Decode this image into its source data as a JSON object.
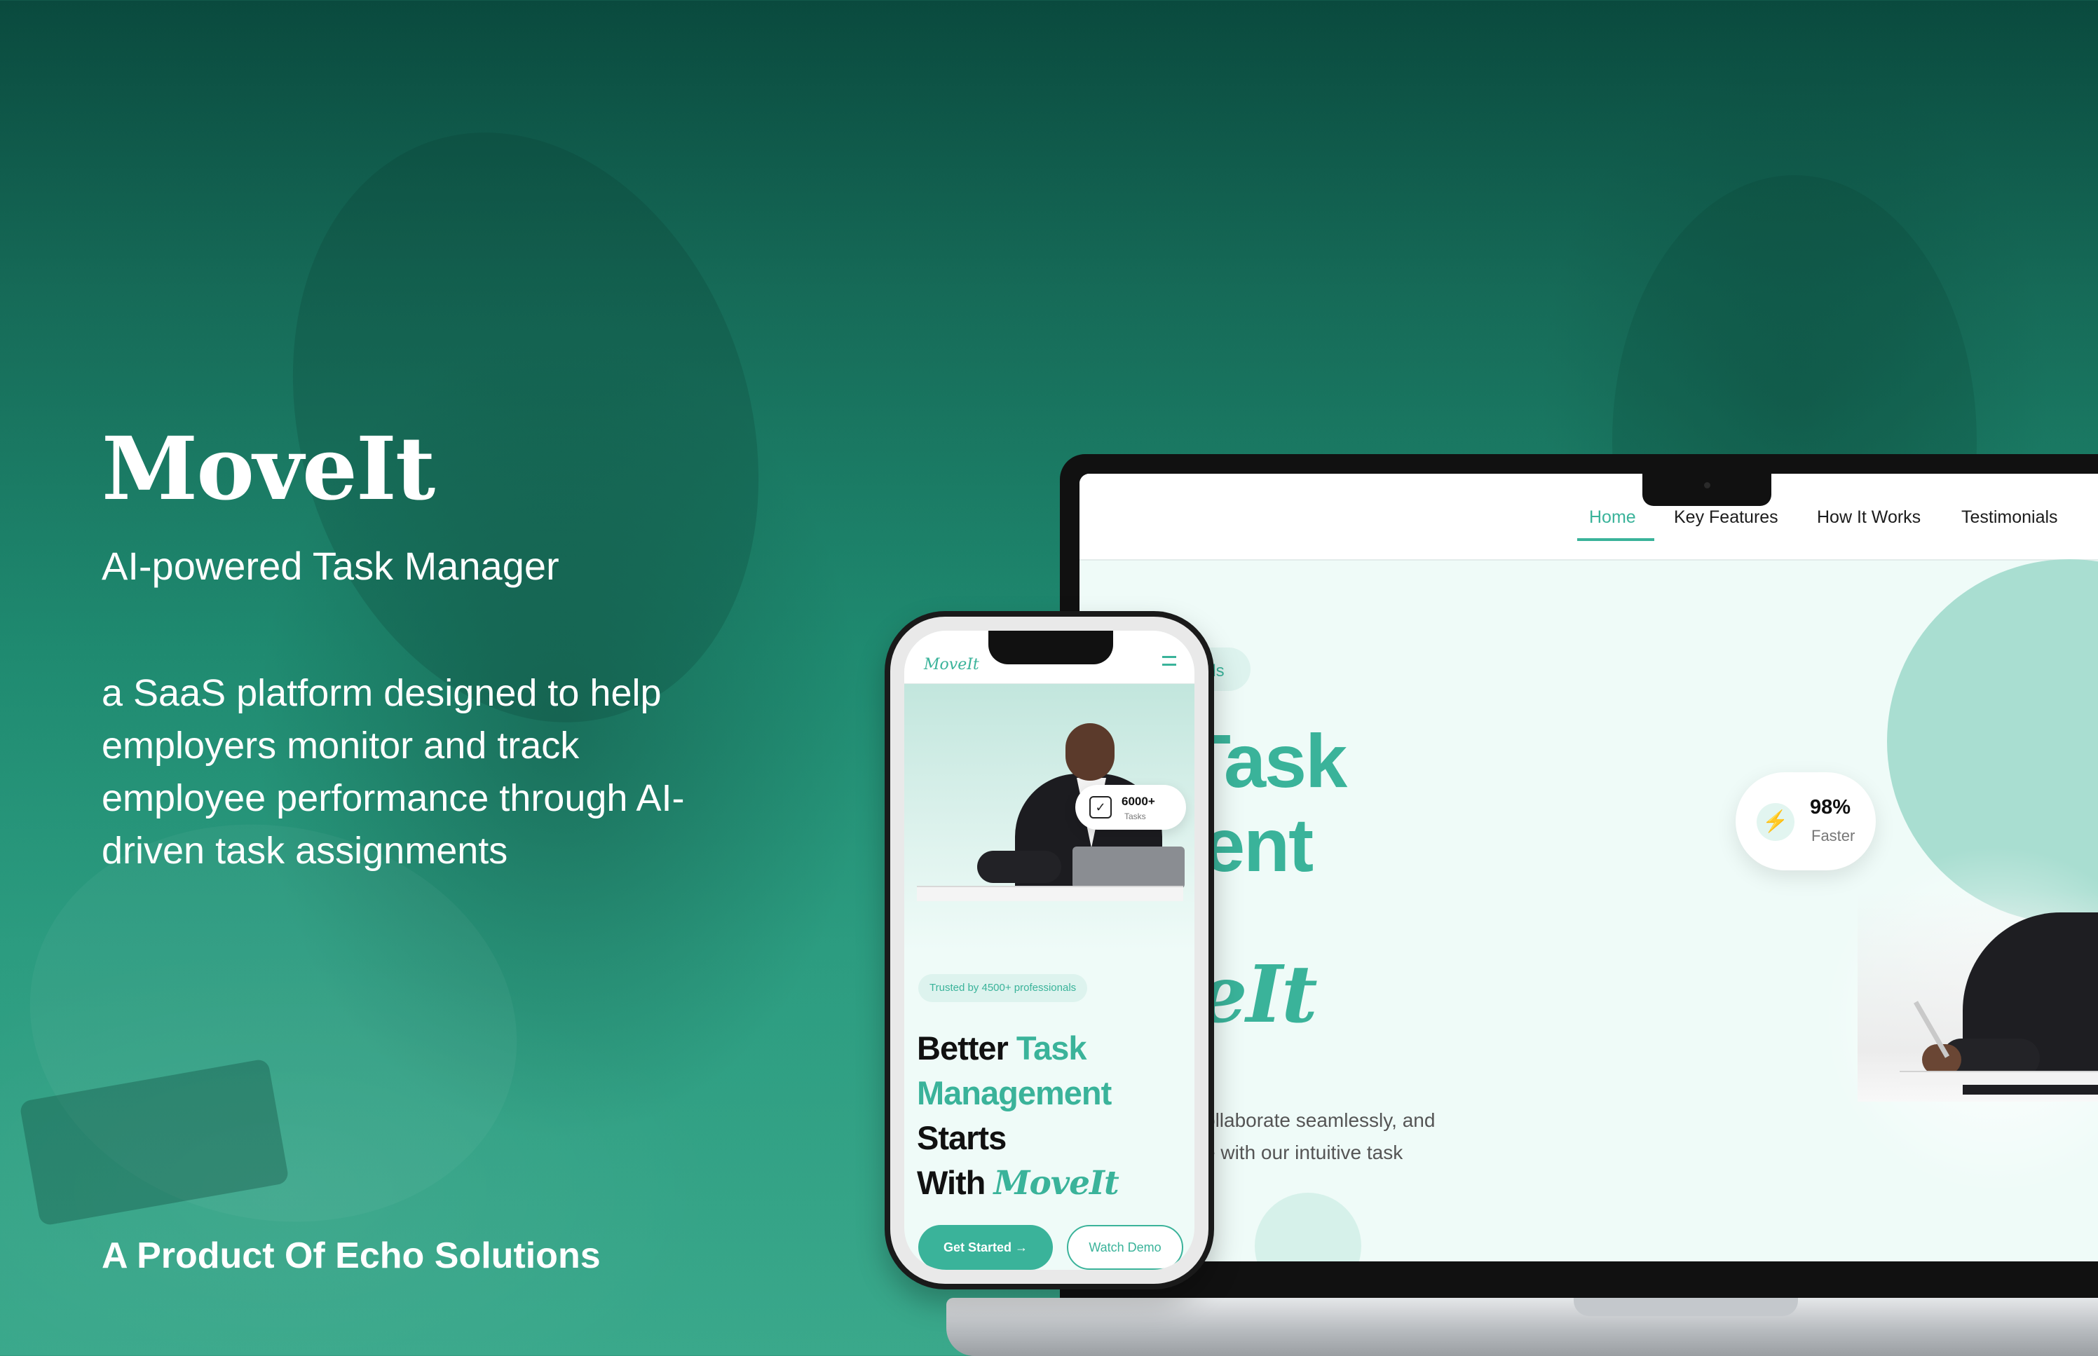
{
  "brand": {
    "title": "MoveIt",
    "subtitle": "AI-powered Task Manager",
    "description": "a SaaS platform designed to help employers monitor and track employee performance through AI-driven task assignments",
    "footer": "A Product Of Echo Solutions"
  },
  "laptop": {
    "nav": {
      "items": [
        "Home",
        "Key Features",
        "How It Works",
        "Testimonials"
      ],
      "active": "Home"
    },
    "hero": {
      "pill_partial": "als",
      "heading_line1_partial": "Task",
      "heading_line2_partial": "ement",
      "heading_brand_partial": "loveIt",
      "paragraph_line1_partial": "ollaborate seamlessly, and",
      "paragraph_line2_partial": "e with our intuitive task"
    },
    "stat": {
      "value": "98%",
      "label": "Faster",
      "icon": "lightning-icon"
    }
  },
  "phone": {
    "logo": "MoveIt",
    "menu_icon": "hamburger-icon",
    "stat": {
      "value": "6000+",
      "label": "Tasks",
      "icon": "checkbox-icon"
    },
    "trusted": "Trusted by 4500+ professionals",
    "heading": {
      "line1_plain": "Better",
      "line1_accent": "Task",
      "line2_accent": "Management",
      "line3_plain": "Starts",
      "line4_plain": "With",
      "line4_brand": "MoveIt"
    },
    "buttons": {
      "primary": "Get Started →",
      "secondary": "Watch Demo"
    }
  },
  "colors": {
    "accent": "#3ab39a",
    "background_dark": "#0a4a3e",
    "background_light": "#3aa88b",
    "hero_surface": "#effbf8"
  }
}
